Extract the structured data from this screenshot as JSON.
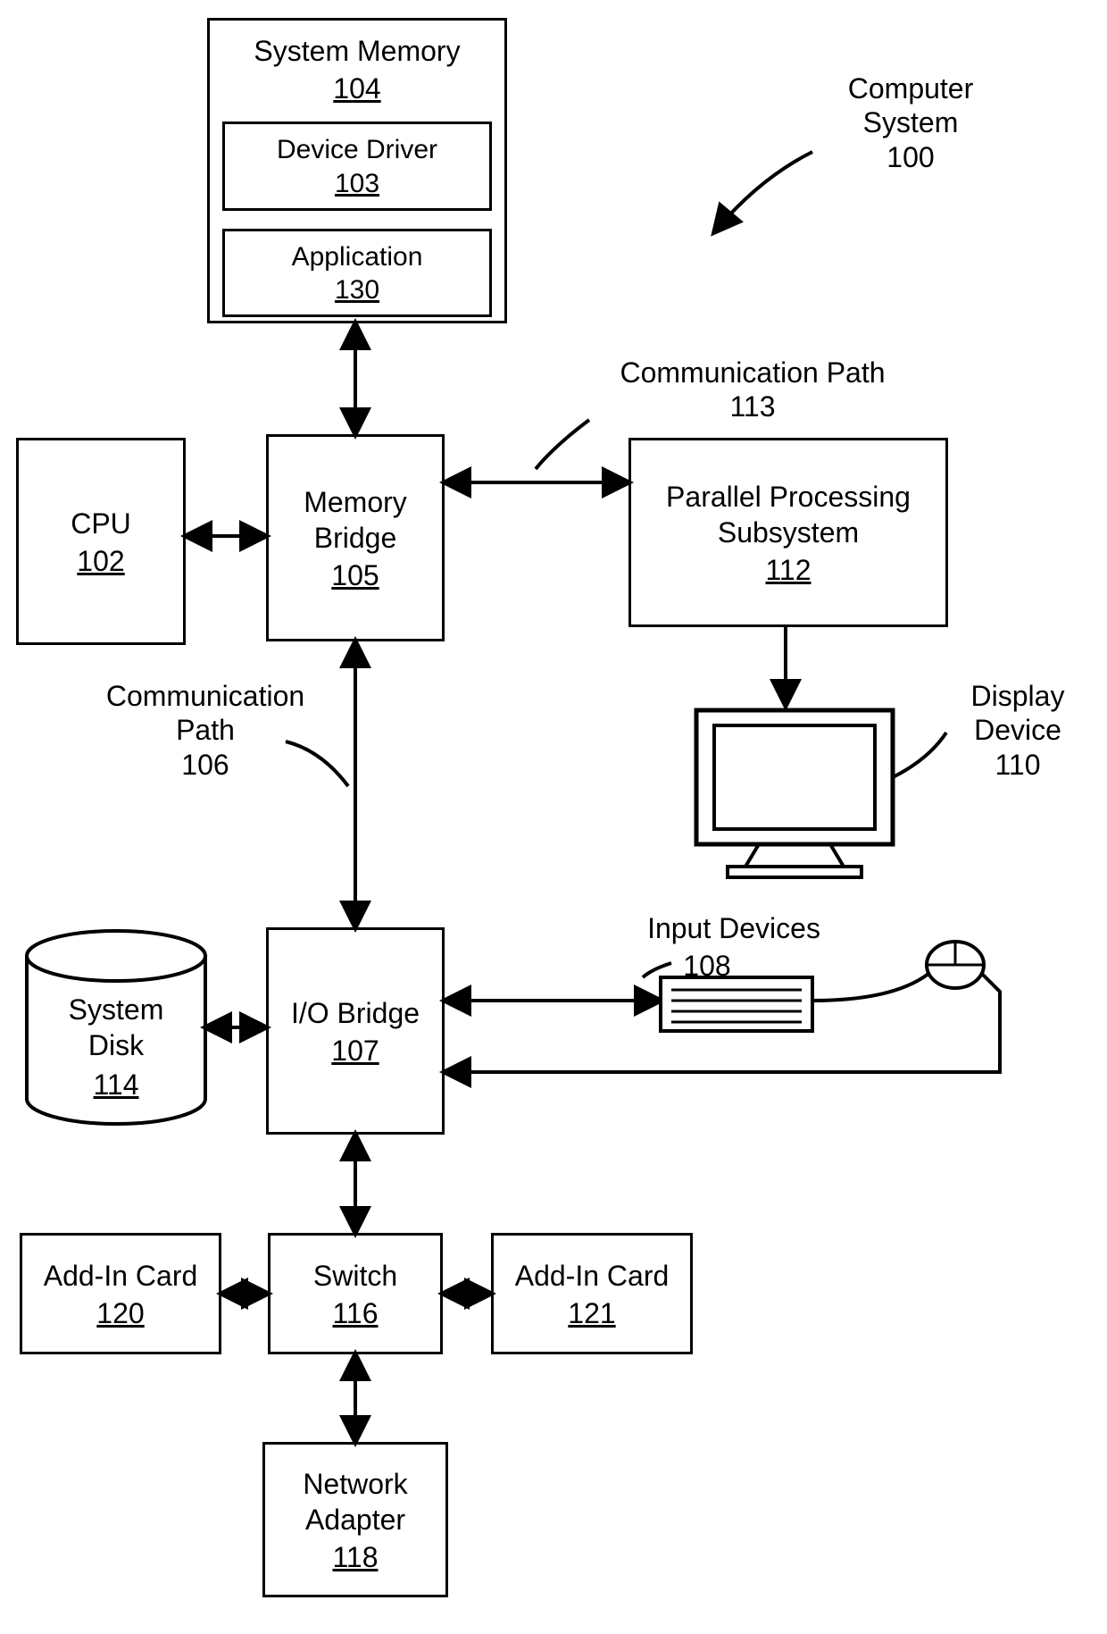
{
  "callout": {
    "title": "Computer\nSystem",
    "num": "100"
  },
  "system_memory": {
    "title": "System Memory",
    "num": "104"
  },
  "device_driver": {
    "title": "Device Driver",
    "num": "103"
  },
  "application": {
    "title": "Application",
    "num": "130"
  },
  "cpu": {
    "title": "CPU",
    "num": "102"
  },
  "memory_bridge": {
    "title": "Memory\nBridge",
    "num": "105"
  },
  "pps": {
    "title": "Parallel Processing\nSubsystem",
    "num": "112"
  },
  "comm_path_113": {
    "title": "Communication Path",
    "num": "113"
  },
  "comm_path_106": {
    "title": "Communication\nPath",
    "num": "106"
  },
  "display_device": {
    "title": "Display\nDevice",
    "num": "110"
  },
  "input_devices": {
    "title": "Input Devices",
    "num": "108"
  },
  "io_bridge": {
    "title": "I/O Bridge",
    "num": "107"
  },
  "system_disk": {
    "title": "System\nDisk",
    "num": "114"
  },
  "addin_120": {
    "title": "Add-In Card",
    "num": "120"
  },
  "switch": {
    "title": "Switch",
    "num": "116"
  },
  "addin_121": {
    "title": "Add-In Card",
    "num": "121"
  },
  "network_adapter": {
    "title": "Network\nAdapter",
    "num": "118"
  }
}
